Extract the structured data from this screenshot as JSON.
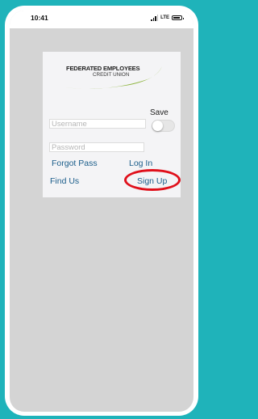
{
  "status_bar": {
    "time": "10:41",
    "network": "LTE"
  },
  "logo": {
    "line1": "FEDERATED EMPLOYEES",
    "line2": "CREDIT UNION",
    "accent_color": "#8bb33a"
  },
  "login": {
    "username_placeholder": "Username",
    "password_placeholder": "Password",
    "save_label": "Save",
    "save_enabled": false
  },
  "links": {
    "forgot_pass": "Forgot Pass",
    "log_in": "Log In",
    "find_us": "Find Us",
    "sign_up": "Sign Up"
  },
  "colors": {
    "link": "#1a5d8a",
    "highlight": "#e0101b",
    "frame": "#1fb3ba"
  }
}
